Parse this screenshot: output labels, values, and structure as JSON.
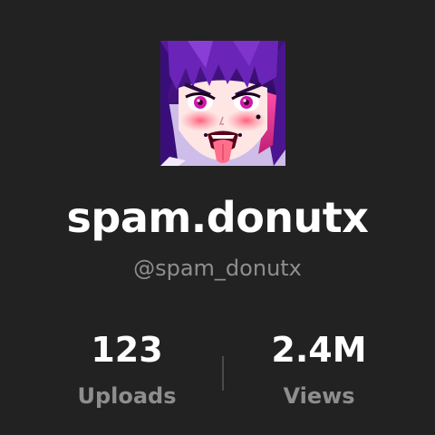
{
  "profile": {
    "avatar_icon": "avatar-image",
    "display_name": "spam.donutx",
    "handle": "@spam_donutx"
  },
  "stats": {
    "uploads": {
      "value": "123",
      "label": "Uploads"
    },
    "views": {
      "value": "2.4M",
      "label": "Views"
    }
  },
  "colors": {
    "background": "#222222",
    "primary_text": "#ffffff",
    "secondary_text": "#8e8e8e",
    "divider": "#4a4a4a"
  }
}
